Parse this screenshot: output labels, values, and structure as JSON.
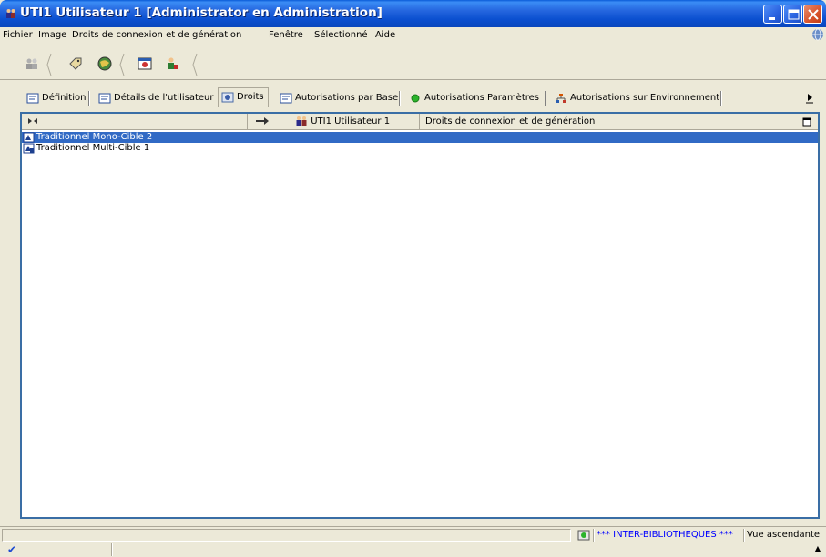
{
  "window": {
    "title": "UTI1 Utilisateur 1 [Administrator en Administration]"
  },
  "menu": [
    "Fichier",
    "Image",
    "Droits de connexion et de génération",
    "Fenêtre",
    "Sélectionné",
    "Aide"
  ],
  "toolbar": {
    "icons": [
      "users-icon",
      "tag-icon",
      "globe-icon",
      "window-icon",
      "person-icon"
    ]
  },
  "tabs": [
    {
      "label": "Définition",
      "icon": "form-icon",
      "active": false
    },
    {
      "label": "Détails de l'utilisateur",
      "icon": "form-icon",
      "active": false
    },
    {
      "label": "Droits",
      "icon": "rights-icon",
      "active": true
    },
    {
      "label": "Autorisations par Base",
      "icon": "form-icon",
      "active": false
    },
    {
      "label": "Autorisations Paramètres",
      "icon": "green-dot-icon",
      "active": false
    },
    {
      "label": "Autorisations sur Environnement",
      "icon": "environment-icon",
      "active": false
    }
  ],
  "grid": {
    "columns": [
      "",
      "",
      "UTI1 Utilisateur 1",
      "Droits de connexion et de génération"
    ],
    "rows": [
      {
        "label": "Traditionnel Mono-Cible 2",
        "selected": true
      },
      {
        "label": "Traditionnel Multi-Cible 1",
        "selected": false
      }
    ]
  },
  "status": {
    "library": "*** INTER-BIBLIOTHEQUES ***",
    "view": "Vue ascendante"
  },
  "colors": {
    "title_bar": "#0a5bd8",
    "selection": "#316ac5",
    "library_text": "#0000ff"
  }
}
